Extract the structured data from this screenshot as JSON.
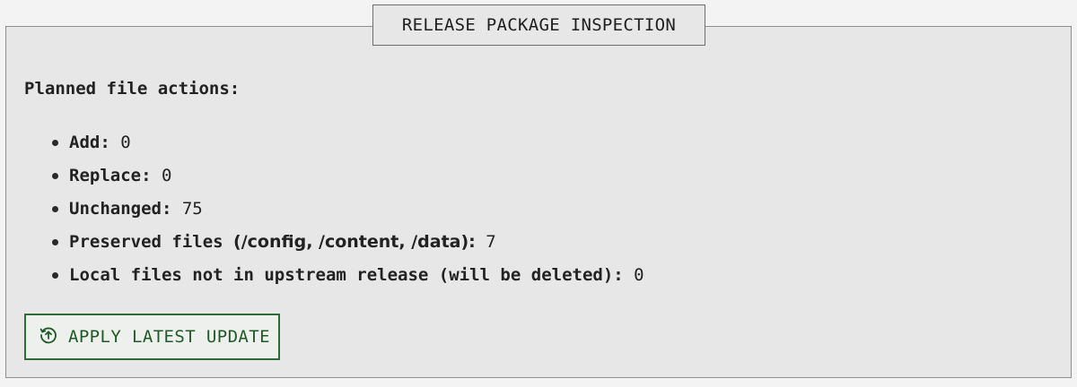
{
  "panel": {
    "title": "RELEASE PACKAGE INSPECTION"
  },
  "plan": {
    "heading": "Planned file actions:",
    "items": [
      {
        "label": "Add:",
        "value": "0"
      },
      {
        "label": "Replace:",
        "value": "0"
      },
      {
        "label": "Unchanged:",
        "value": "75"
      },
      {
        "label": "Preserved files",
        "paths": "(/config, /content, /data):",
        "value": "7"
      },
      {
        "label": "Local files not in upstream release (will be deleted):",
        "value": "0"
      }
    ]
  },
  "actions": {
    "apply_label": "APPLY LATEST UPDATE",
    "apply_icon": "circle-arrow-up-icon",
    "accent_color": "#2f6b34"
  }
}
